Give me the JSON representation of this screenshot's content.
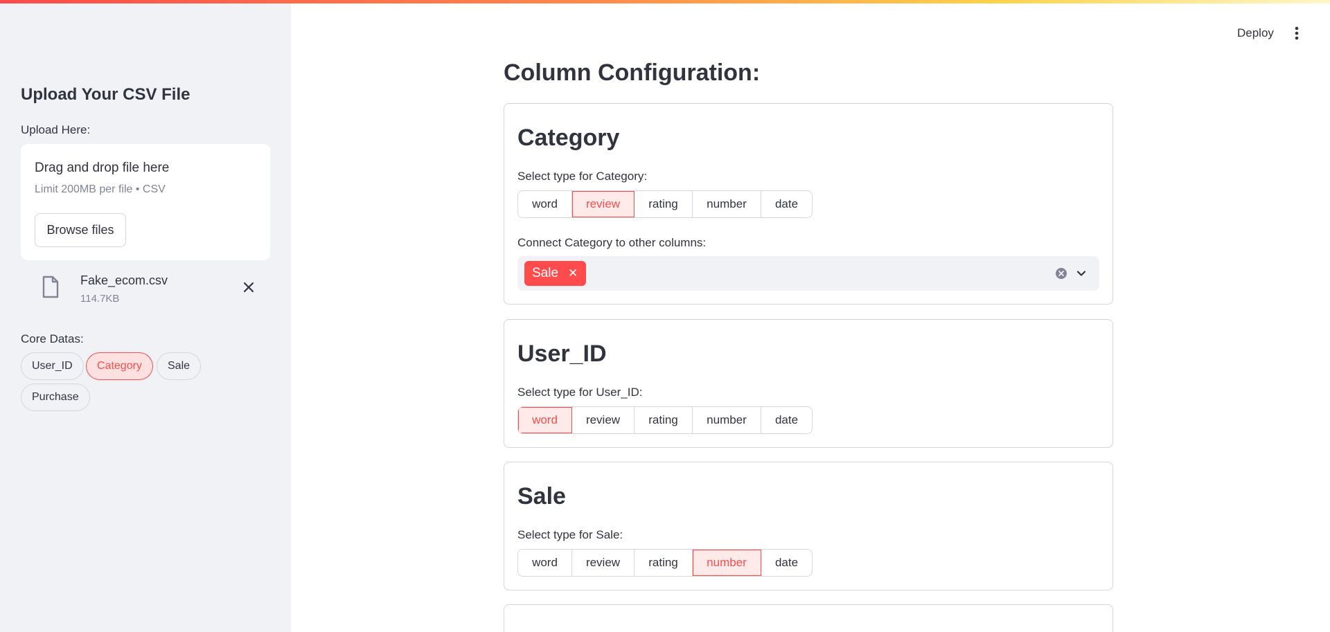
{
  "header": {
    "deploy_label": "Deploy",
    "menu_icon": "more-vertical-icon"
  },
  "sidebar": {
    "title": "Upload Your CSV File",
    "upload_label": "Upload Here:",
    "dropzone": {
      "title": "Drag and drop file here",
      "limit": "Limit 200MB per file • CSV",
      "browse_label": "Browse files"
    },
    "file": {
      "name": "Fake_ecom.csv",
      "size": "114.7KB",
      "icon": "file-icon",
      "remove_icon": "close-icon"
    },
    "core_label": "Core Datas:",
    "core_pills": [
      {
        "label": "User_ID",
        "selected": false
      },
      {
        "label": "Category",
        "selected": true
      },
      {
        "label": "Sale",
        "selected": false
      },
      {
        "label": "Purchase",
        "selected": false
      }
    ]
  },
  "main": {
    "title": "Column Configuration:",
    "type_options": [
      "word",
      "review",
      "rating",
      "number",
      "date"
    ],
    "cards": [
      {
        "title": "Category",
        "type_label": "Select type for Category:",
        "selected_type": "review",
        "connect_label": "Connect Category to other columns:",
        "connected": [
          "Sale"
        ]
      },
      {
        "title": "User_ID",
        "type_label": "Select type for User_ID:",
        "selected_type": "word"
      },
      {
        "title": "Sale",
        "type_label": "Select type for Sale:",
        "selected_type": "number"
      }
    ]
  },
  "colors": {
    "accent": "#ff4b4b",
    "accent_bg": "#ffeaea",
    "sidebar_bg": "#f0f2f6",
    "text": "#31333f",
    "muted": "#808495"
  }
}
